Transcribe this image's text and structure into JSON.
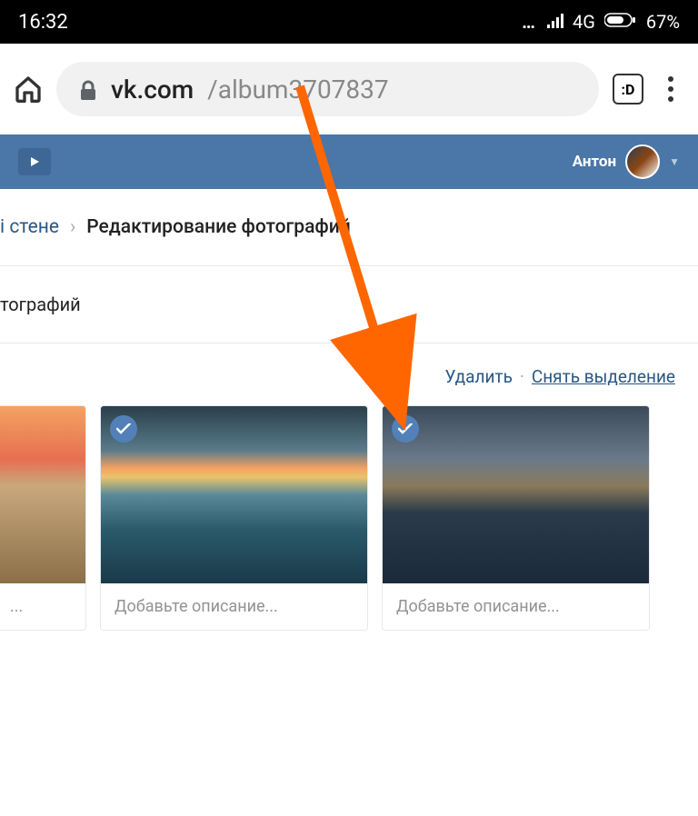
{
  "status": {
    "time": "16:32",
    "network": "4G",
    "battery": "67%"
  },
  "browser": {
    "url_domain": "vk.com",
    "url_path": "/album3707837",
    "tab_label": ":D"
  },
  "vk_header": {
    "username": "Антон"
  },
  "breadcrumb": {
    "prev": "і стене",
    "current": "Редактирование фотографий"
  },
  "section": {
    "label": "тографий"
  },
  "actions": {
    "delete": "Удалить",
    "deselect": "Снять выделение"
  },
  "photos": [
    {
      "caption_placeholder": "..."
    },
    {
      "caption_placeholder": "Добавьте описание...",
      "selected": true
    },
    {
      "caption_placeholder": "Добавьте описание...",
      "selected": true
    }
  ]
}
